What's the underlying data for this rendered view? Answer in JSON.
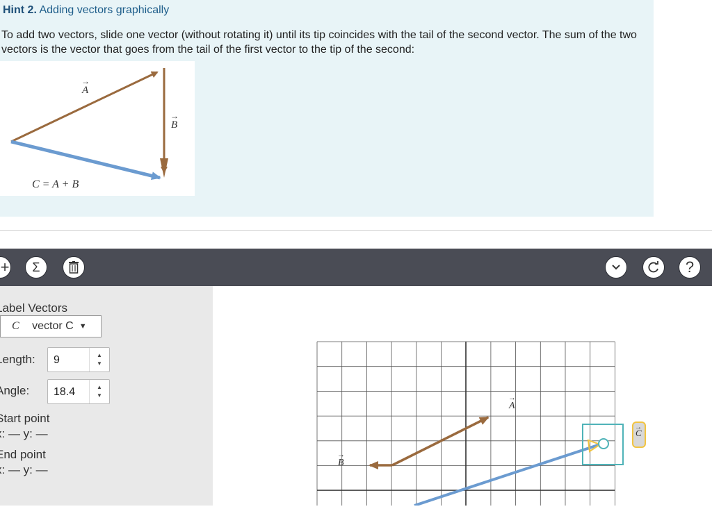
{
  "hint": {
    "number": "Hint 2.",
    "title": "Adding vectors graphically",
    "body": "To add two vectors, slide one vector (without rotating it) until its tip coincides with the tail of the second vector. The sum of the two vectors is the vector that goes from the tail of the first vector to the tip of the second:",
    "figure": {
      "label_a": "A",
      "label_b": "B",
      "equation": "C = A + B"
    }
  },
  "toolbar": {
    "add_icon": "plus-icon",
    "sum_icon": "sigma-icon",
    "delete_icon": "trash-icon",
    "collapse_icon": "chevron-down-icon",
    "reset_icon": "reset-icon",
    "help_label": "?"
  },
  "panel": {
    "label_vectors": "Label Vectors",
    "selected_vector": "vector C",
    "length_label": "Length:",
    "length_value": "9",
    "angle_label": "Angle:",
    "angle_value": "18.4",
    "start_label": "Start point",
    "start_coords": "x: — y: —",
    "end_label": "End point",
    "end_coords": "x: — y: —"
  },
  "canvas": {
    "label_a": "A",
    "label_b": "B",
    "label_c": "C"
  },
  "colors": {
    "brown_vector": "#9a6a3e",
    "blue_vector": "#6b9bd0",
    "teal_select": "#4fb3b8",
    "label_highlight": "#f2c440"
  }
}
